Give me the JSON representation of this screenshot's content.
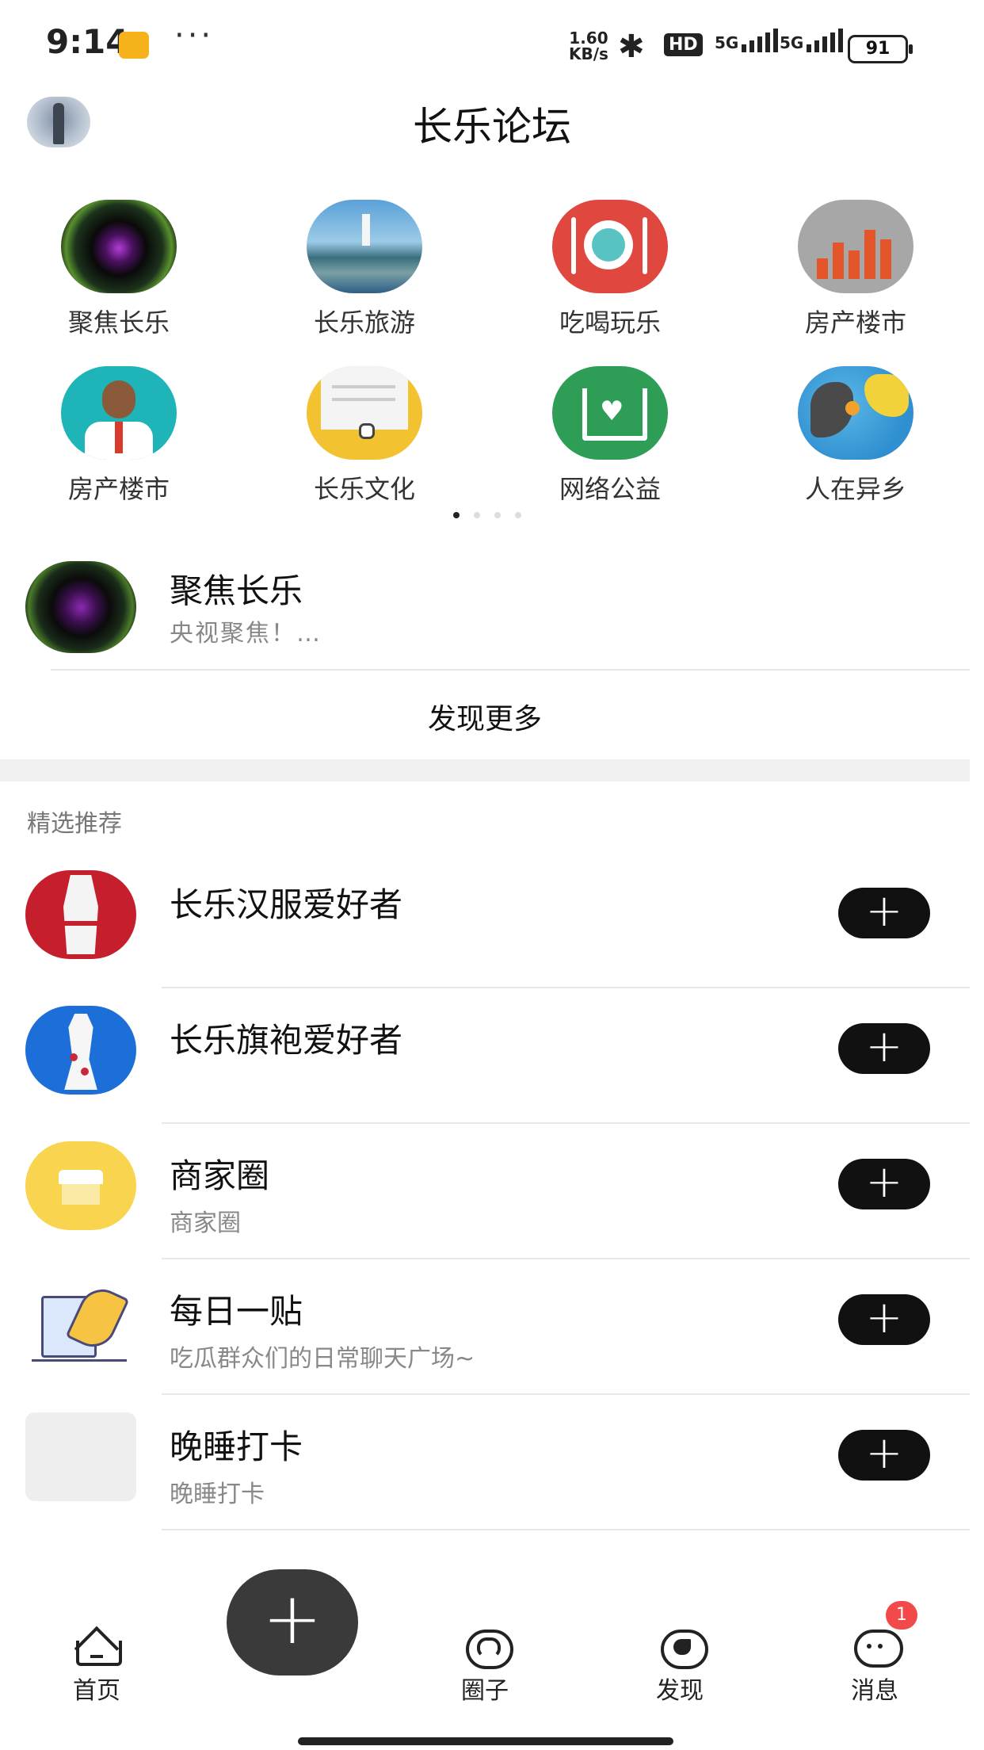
{
  "status_bar": {
    "time": "9:14",
    "dots": "···",
    "net_speed_value": "1.60",
    "net_speed_unit": "KB/s",
    "hd_badge": "HD",
    "signal_1": "5G",
    "signal_2": "5G",
    "battery": "91"
  },
  "header": {
    "title": "长乐论坛"
  },
  "categories": [
    {
      "label": "聚焦长乐",
      "icon": "camera-lens-icon"
    },
    {
      "label": "长乐旅游",
      "icon": "island-lighthouse-icon"
    },
    {
      "label": "吃喝玩乐",
      "icon": "plate-fork-knife-icon"
    },
    {
      "label": "房产楼市",
      "icon": "bar-chart-icon"
    },
    {
      "label": "房产楼市",
      "icon": "headset-agent-icon"
    },
    {
      "label": "长乐文化",
      "icon": "envelope-letter-icon"
    },
    {
      "label": "网络公益",
      "icon": "house-heart-icon"
    },
    {
      "label": "人在异乡",
      "icon": "globe-map-pin-icon"
    }
  ],
  "pager": {
    "total": 4,
    "active": 1
  },
  "featured": {
    "title": "聚焦长乐",
    "subtitle": "央视聚焦！…"
  },
  "discover_more": "发现更多",
  "section": {
    "title": "精选推荐"
  },
  "recommendations": [
    {
      "title": "长乐汉服爱好者",
      "subtitle": "",
      "join": "+"
    },
    {
      "title": "长乐旗袍爱好者",
      "subtitle": "",
      "join": "+"
    },
    {
      "title": "商家圈",
      "subtitle": "商家圈",
      "join": "+"
    },
    {
      "title": "每日一贴",
      "subtitle": "吃瓜群众们的日常聊天广场~",
      "join": "+"
    },
    {
      "title": "晚睡打卡",
      "subtitle": "晚睡打卡",
      "join": "+"
    }
  ],
  "bottom_nav": {
    "home": "首页",
    "circle": "圈子",
    "discover": "发现",
    "messages": "消息",
    "messages_badge": "1",
    "post": "+"
  },
  "colors": {
    "accent": "#111111",
    "fab": "#3a3a3a",
    "badge": "#f24a4a",
    "divider": "#e8e8e8"
  }
}
